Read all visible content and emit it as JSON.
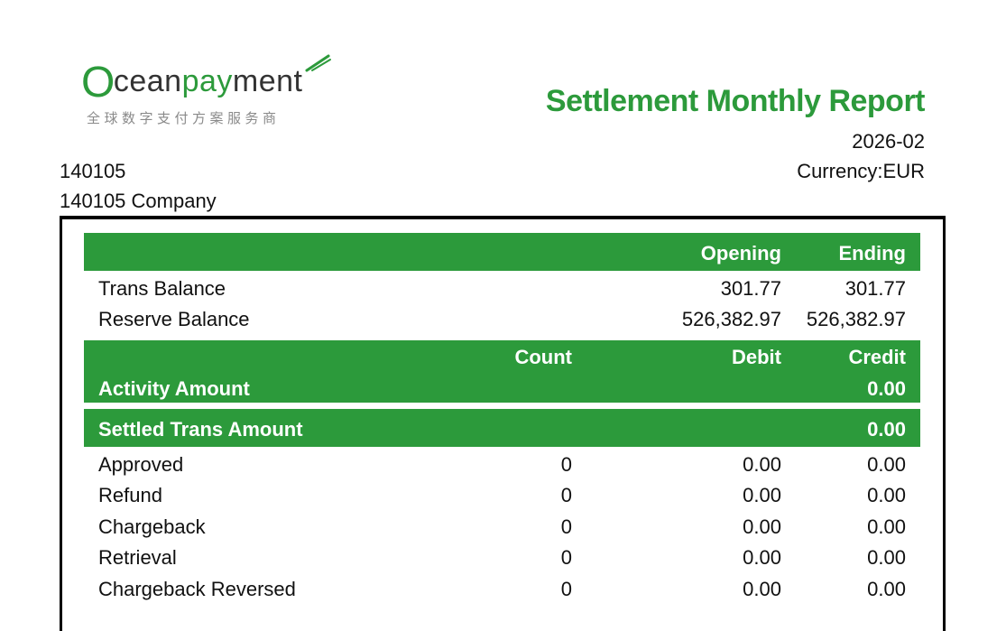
{
  "logo": {
    "o": "O",
    "cean": "cean",
    "pay": "pay",
    "ment": "ment",
    "tagline": "全球数字支付方案服务商"
  },
  "report": {
    "title": "Settlement Monthly Report",
    "period": "2026-02",
    "currency": "Currency:EUR"
  },
  "merchant": {
    "id": "140105",
    "name": "140105 Company"
  },
  "balance": {
    "col_opening": "Opening",
    "col_ending": "Ending",
    "rows": [
      {
        "label": "Trans Balance",
        "opening": "301.77",
        "ending": "301.77"
      },
      {
        "label": "Reserve Balance",
        "opening": "526,382.97",
        "ending": "526,382.97"
      }
    ]
  },
  "activity": {
    "col_count": "Count",
    "col_debit": "Debit",
    "col_credit": "Credit",
    "label": "Activity Amount",
    "credit": "0.00"
  },
  "settled": {
    "label": "Settled Trans Amount",
    "credit": "0.00",
    "rows": [
      {
        "label": "Approved",
        "count": "0",
        "debit": "0.00",
        "credit": "0.00"
      },
      {
        "label": "Refund",
        "count": "0",
        "debit": "0.00",
        "credit": "0.00"
      },
      {
        "label": "Chargeback",
        "count": "0",
        "debit": "0.00",
        "credit": "0.00"
      },
      {
        "label": "Retrieval",
        "count": "0",
        "debit": "0.00",
        "credit": "0.00"
      },
      {
        "label": "Chargeback Reversed",
        "count": "0",
        "debit": "0.00",
        "credit": "0.00"
      }
    ]
  },
  "colors": {
    "brand_green": "#2c9a3b",
    "text": "#111111"
  }
}
